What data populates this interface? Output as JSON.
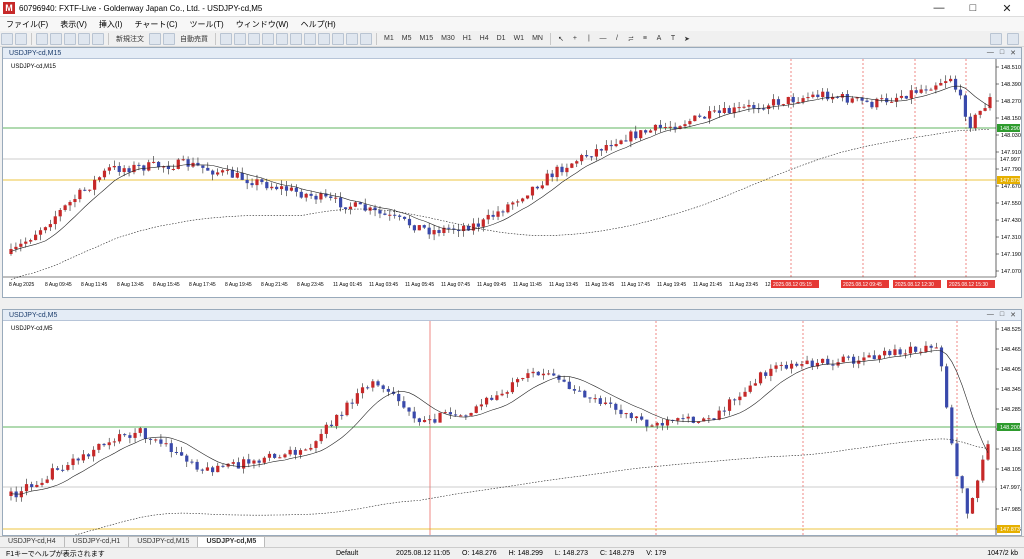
{
  "window": {
    "title": "60796940: FXTF-Live - Goldenway Japan Co., Ltd. - USDJPY-cd,M5"
  },
  "menu": [
    "ファイル(F)",
    "表示(V)",
    "挿入(I)",
    "チャート(C)",
    "ツール(T)",
    "ウィンドウ(W)",
    "ヘルプ(H)"
  ],
  "toolbar": {
    "new_order": "新規注文",
    "auto_trade": "自動売買",
    "timeframes": [
      "M1",
      "M5",
      "M15",
      "M30",
      "H1",
      "H4",
      "D1",
      "W1",
      "MN"
    ]
  },
  "chart1": {
    "window_title": "USDJPY-cd,M15",
    "inner_label": "USDJPY-cd,M15",
    "price_labels": [
      "148.510",
      "148.390",
      "148.270",
      "148.150",
      "148.030",
      "147.910",
      "147.790",
      "147.670",
      "147.550",
      "147.430",
      "147.310",
      "147.190",
      "147.070"
    ],
    "green_level": "148.290",
    "current_price": "147.997",
    "yellow_level": "147.873",
    "time_labels": [
      "8 Aug 2025",
      "8 Aug 09:45",
      "8 Aug 11:45",
      "8 Aug 13:45",
      "8 Aug 15:45",
      "8 Aug 17:45",
      "8 Aug 19:45",
      "8 Aug 21:45",
      "8 Aug 23:45",
      "11 Aug 01:45",
      "11 Aug 03:45",
      "11 Aug 05:45",
      "11 Aug 07:45",
      "11 Aug 09:45",
      "11 Aug 11:45",
      "11 Aug 13:45",
      "11 Aug 15:45",
      "11 Aug 17:45",
      "11 Aug 19:45",
      "11 Aug 21:45",
      "11 Aug 23:45",
      "12 Aug 01:45"
    ],
    "marker_labels": [
      "2025.08.12 05:15",
      "2025.08.12 09:45",
      "2025.08.12 12:30",
      "2025.08.12 15:30"
    ]
  },
  "chart2": {
    "window_title": "USDJPY-cd,M5",
    "inner_label": "USDJPY-cd,M5",
    "price_labels": [
      "148.525",
      "148.465",
      "148.405",
      "148.345",
      "148.285",
      "148.225",
      "148.165",
      "148.105",
      "148.045",
      "147.985",
      "147.925"
    ],
    "green_level": "148.200",
    "current_price": "147.997",
    "yellow_level": "147.873"
  },
  "tabs": [
    "USDJPY-cd,H4",
    "USDJPY-cd,H1",
    "USDJPY-cd,M15",
    "USDJPY-cd,M5"
  ],
  "active_tab": "USDJPY-cd,M5",
  "status": {
    "help": "F1キーでヘルプが表示されます",
    "profile": "Default",
    "datetime": "2025.08.12 11:05",
    "open": "O: 148.276",
    "high": "H: 148.299",
    "low": "L: 148.273",
    "close": "C: 148.279",
    "volume": "V: 179",
    "traffic": "1047/2 kb"
  },
  "colors": {
    "bull": "#c62828",
    "bear": "#3949ab",
    "green_line": "#2e9b2e",
    "yellow_line": "#e6b000",
    "marker": "#e53935"
  }
}
